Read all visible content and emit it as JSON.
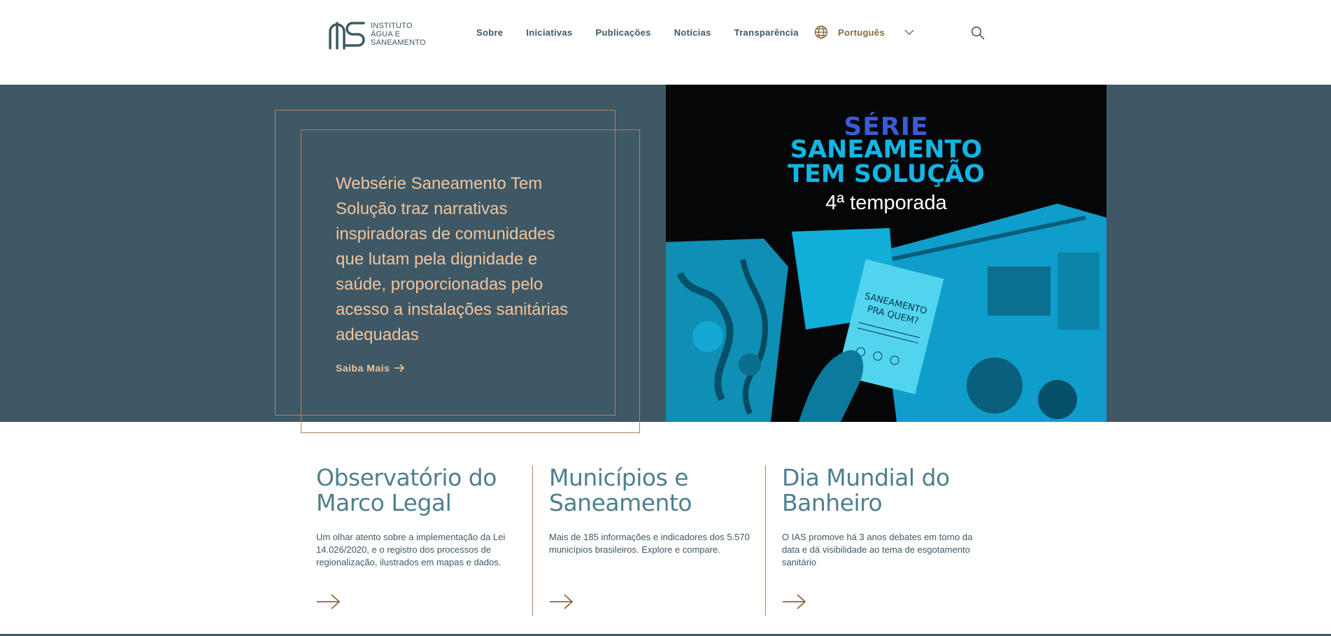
{
  "logo": {
    "line1": "INSTITUTO",
    "line2": "ÁGUA E",
    "line3": "SANEAMENTO"
  },
  "nav": {
    "items": [
      {
        "label": "Sobre"
      },
      {
        "label": "Iniciativas"
      },
      {
        "label": "Publicações"
      },
      {
        "label": "Notícias"
      },
      {
        "label": "Transparência"
      }
    ],
    "language": "Português",
    "icons": {
      "globe": "globe-icon",
      "chevron": "chevron-down-icon",
      "search": "search-icon"
    }
  },
  "hero": {
    "text": "Websérie Saneamento Tem Solução traz narrativas inspiradoras de comunidades que lutam pela dignidade e saúde, proporcionadas pelo acesso a instalações sanitárias adequadas",
    "link_label": "Saiba Mais",
    "banner": {
      "line1": "SÉRIE",
      "line2": "SANEAMENTO",
      "line3": "TEM SOLUÇÃO",
      "subtitle": "4ª temporada",
      "booklet_title": "SANEAMENTO PRA QUEM?"
    }
  },
  "cards": [
    {
      "title": "Observatório do Marco Legal",
      "description": "Um olhar atento sobre a implementação da Lei 14.026/2020, e o registro dos processos de regionalização, ilustrados em mapas e dados."
    },
    {
      "title": "Municípios e Saneamento",
      "description": "Mais de 185 informações e indicadores dos 5.570 municípios brasileiros. Explore e compare."
    },
    {
      "title": "Dia Mundial do Banheiro",
      "description": "O IAS promove há 3 anos debates em torno da data e dá visibilidade ao tema de esgotamento sanitário"
    }
  ],
  "colors": {
    "primary": "#3e5866",
    "accent": "#b4825a",
    "hero_text": "#f2c49a",
    "card_title": "#4f7f8e",
    "banner_cyan": "#12b5e4",
    "banner_blue": "#3b5bd4"
  }
}
